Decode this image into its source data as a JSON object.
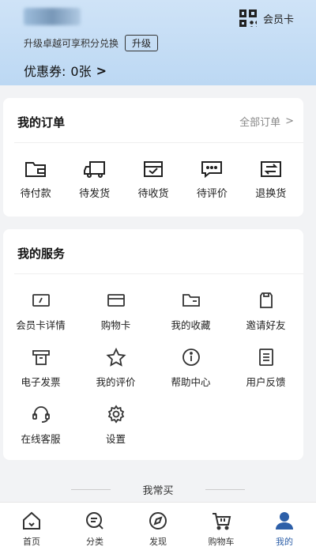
{
  "header": {
    "member_card_label": "会员卡",
    "upgrade_text": "升级卓越可享积分兑换",
    "upgrade_button": "升级",
    "coupon_label": "优惠券:",
    "coupon_value": "0张",
    "coupon_chevron": ">"
  },
  "orders": {
    "title": "我的订单",
    "all_orders_label": "全部订单",
    "all_orders_chevron": ">",
    "items": [
      {
        "label": "待付款",
        "icon": "wallet-icon"
      },
      {
        "label": "待发货",
        "icon": "truck-icon"
      },
      {
        "label": "待收货",
        "icon": "inbox-check-icon"
      },
      {
        "label": "待评价",
        "icon": "comment-icon"
      },
      {
        "label": "退换货",
        "icon": "exchange-icon"
      }
    ]
  },
  "services": {
    "title": "我的服务",
    "items": [
      {
        "label": "会员卡详情",
        "icon": "member-card-icon"
      },
      {
        "label": "购物卡",
        "icon": "shopping-card-icon"
      },
      {
        "label": "我的收藏",
        "icon": "folder-icon"
      },
      {
        "label": "邀请好友",
        "icon": "invite-icon"
      },
      {
        "label": "电子发票",
        "icon": "invoice-icon"
      },
      {
        "label": "我的评价",
        "icon": "star-icon"
      },
      {
        "label": "帮助中心",
        "icon": "info-icon"
      },
      {
        "label": "用户反馈",
        "icon": "feedback-icon"
      },
      {
        "label": "在线客服",
        "icon": "headset-icon"
      },
      {
        "label": "设置",
        "icon": "gear-icon"
      }
    ]
  },
  "frequent_label": "我常买",
  "bottom_nav": {
    "active_color": "#2d5fa8",
    "items": [
      {
        "label": "首页",
        "icon": "home-icon"
      },
      {
        "label": "分类",
        "icon": "category-search-icon"
      },
      {
        "label": "发现",
        "icon": "compass-icon"
      },
      {
        "label": "购物车",
        "icon": "cart-icon"
      },
      {
        "label": "我的",
        "icon": "user-icon"
      }
    ]
  }
}
